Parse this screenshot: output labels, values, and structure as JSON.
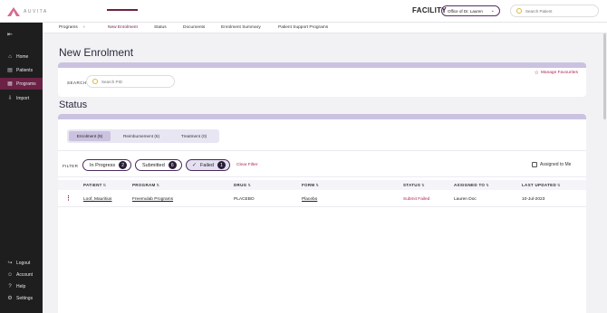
{
  "header": {
    "logo_text": "AUVITA",
    "facility_label": "FACILITY",
    "facility_select": "Office of Dr. Lauren",
    "search_placeholder": "Search Patient"
  },
  "sidebar": {
    "items": [
      {
        "label": "Home",
        "icon": "home-icon"
      },
      {
        "label": "Patients",
        "icon": "patients-icon"
      },
      {
        "label": "Programs",
        "icon": "programs-icon",
        "active": true
      },
      {
        "label": "Import",
        "icon": "import-icon"
      }
    ],
    "bottom_items": [
      {
        "label": "Logout",
        "icon": "logout-icon"
      },
      {
        "label": "Account",
        "icon": "account-icon"
      },
      {
        "label": "Help",
        "icon": "help-icon"
      },
      {
        "label": "Settings",
        "icon": "gear-icon"
      }
    ]
  },
  "subnav": {
    "items": [
      "Programs",
      "New Enrolment",
      "Status",
      "Documents",
      "Enrolment Summary",
      "Patient Support Programs"
    ],
    "active": "New Enrolment"
  },
  "main": {
    "title": "New Enrolment",
    "manage_favourites": "Manage Favourites",
    "search_label": "SEARCH",
    "search_placeholder": "Search PID",
    "status_title": "Status",
    "tabs": [
      {
        "label": "Enrolment (9)",
        "active": true
      },
      {
        "label": "Reimbursement (6)"
      },
      {
        "label": "Treatment (0)"
      }
    ],
    "filter_label": "FILTER",
    "chips": [
      {
        "label": "In Progress",
        "count": "2",
        "checked": false
      },
      {
        "label": "Submitted",
        "count": "6",
        "checked": false
      },
      {
        "label": "Failed",
        "count": "1",
        "checked": true
      }
    ],
    "clear_filter": "Clear Filter",
    "assigned_to_me": "Assigned to Me"
  },
  "table": {
    "columns": [
      "PATIENT",
      "PROGRAM",
      "DRUG",
      "FORM",
      "STATUS",
      "ASSIGNED TO",
      "LAST UPDATED"
    ],
    "rows": [
      {
        "patient": "Loof, Mauritius",
        "program": "Freemulab Programs",
        "drug": "PLACEBO",
        "form": "Placebo",
        "status": "Submit Failed",
        "assigned_to": "Lauren Doc",
        "last_updated": "10-Jul-2023"
      }
    ]
  },
  "colors": {
    "accent": "#6b2245",
    "link_red": "#b3235a",
    "band": "#cbc2e0",
    "sidebar_bg": "#1e1e1e"
  }
}
